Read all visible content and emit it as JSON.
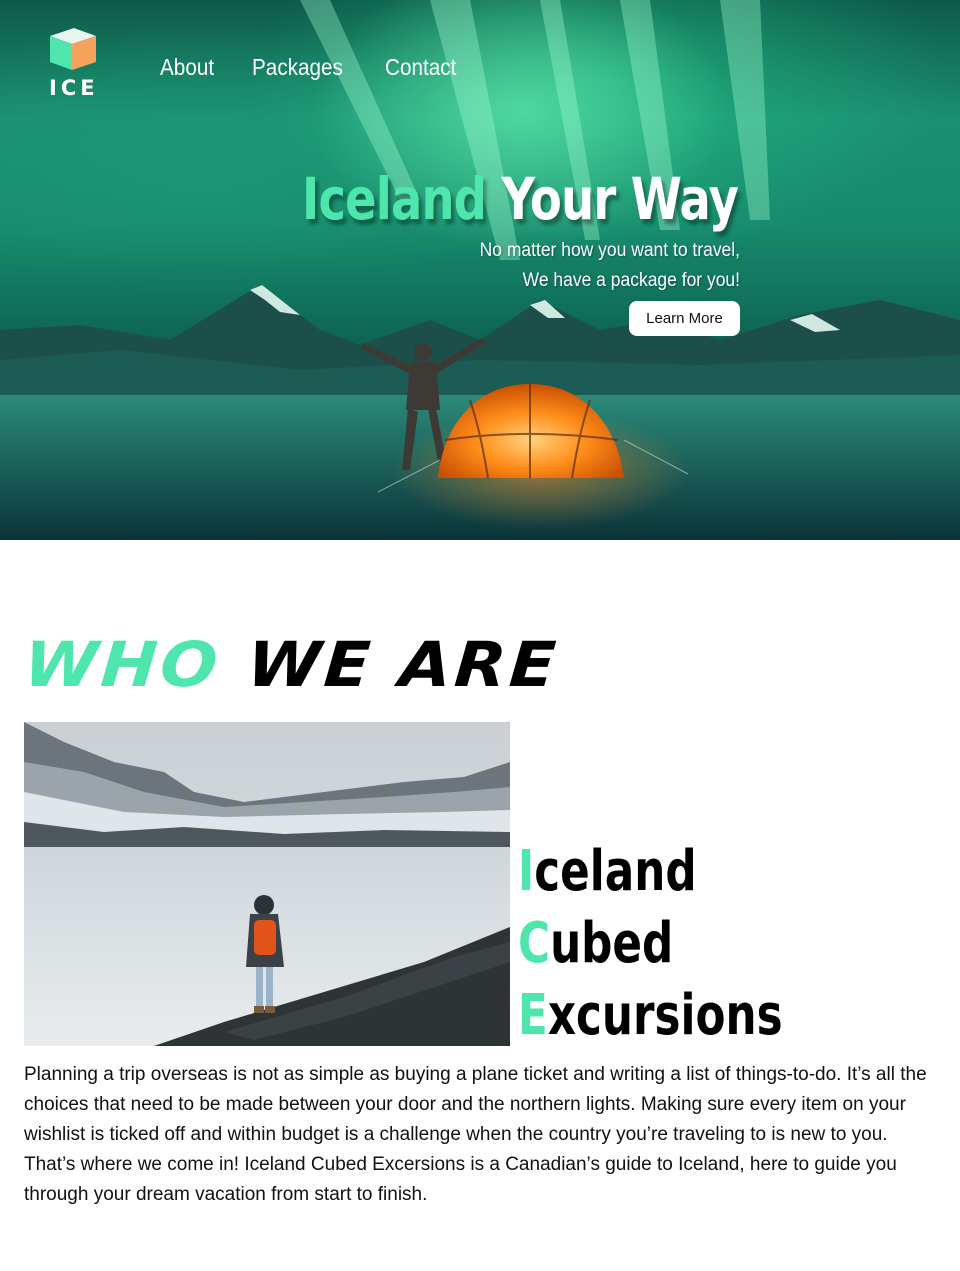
{
  "brand": {
    "logo_text": "ICE",
    "accent_color": "#4ee6ad"
  },
  "nav": {
    "items": [
      {
        "label": "About"
      },
      {
        "label": "Packages"
      },
      {
        "label": "Contact"
      }
    ]
  },
  "hero": {
    "title_accent": "Iceland",
    "title_rest": "Your Way",
    "subtitle_line1": "No matter how you want to travel,",
    "subtitle_line2": "We have a package for you!",
    "button_label": "Learn More"
  },
  "who": {
    "title_accent": "WHO",
    "title_rest": "WE ARE",
    "acronym": [
      {
        "first": "I",
        "rest": "celand"
      },
      {
        "first": "C",
        "rest": "ubed"
      },
      {
        "first": "E",
        "rest": "xcursions"
      }
    ],
    "paragraph": "Planning a trip overseas is not as simple as buying a plane ticket and writing a list of things-to-do. It’s all the choices that need to be made between your door and the northern lights. Making sure every item on your wishlist is ticked off and within budget is a challenge when the country you’re traveling to is new to you. That’s where we come in! Iceland Cubed Excersions is a Canadian’s guide to Iceland, here to guide you through your dream vacation from start to finish."
  }
}
